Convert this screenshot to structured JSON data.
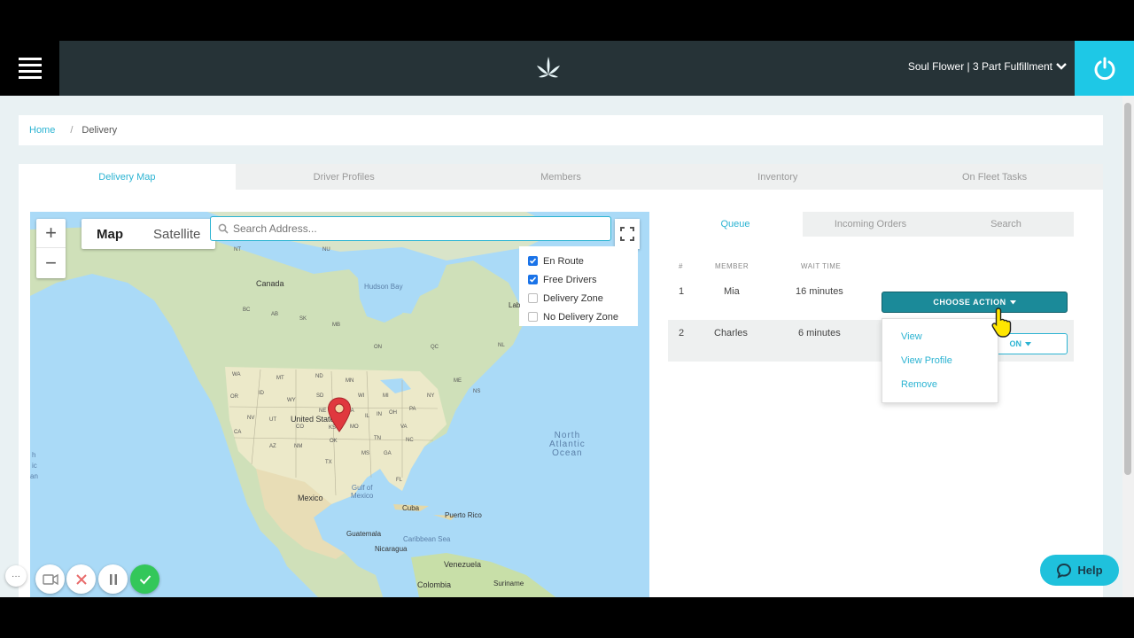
{
  "header": {
    "account_label": "Soul Flower | 3 Part Fulfillment",
    "icons": {
      "menu": "hamburger-icon",
      "logo": "leaf-logo",
      "power": "power-icon",
      "chevron": "chevron-down-icon"
    }
  },
  "breadcrumb": {
    "home": "Home",
    "separator": "/",
    "current": "Delivery"
  },
  "tabs": [
    "Delivery Map",
    "Driver Profiles",
    "Members",
    "Inventory",
    "On Fleet Tasks"
  ],
  "map": {
    "zoom_in": "+",
    "zoom_out": "−",
    "type_map": "Map",
    "type_satellite": "Satellite",
    "search_placeholder": "Search Address...",
    "filters": [
      {
        "label": "En Route",
        "checked": true
      },
      {
        "label": "Free Drivers",
        "checked": true
      },
      {
        "label": "Delivery Zone",
        "checked": false
      },
      {
        "label": "No Delivery Zone",
        "checked": false
      }
    ],
    "labels": {
      "canada": "Canada",
      "hudson_bay": "Hudson Bay",
      "united_states": "United States",
      "mexico": "Mexico",
      "gulf": "Gulf of\nMexico",
      "atlantic": "North\nAtlantic\nOcean",
      "cuba": "Cuba",
      "puerto_rico": "Puerto Rico",
      "caribbean": "Caribbean Sea",
      "guatemala": "Guatemala",
      "nicaragua": "Nicaragua",
      "venezuela": "Venezuela",
      "colombia": "Colombia",
      "suriname": "Suriname",
      "lab": "Lab",
      "pac1": "h",
      "pac2": "ic",
      "pac3": "an",
      "nt": "NT",
      "nu": "NU",
      "bc": "BC",
      "ab": "AB",
      "sk": "SK",
      "mb": "MB",
      "on": "ON",
      "qc": "QC",
      "nl": "NL",
      "wa": "WA",
      "mt": "MT",
      "nd": "ND",
      "mn": "MN",
      "or": "OR",
      "id": "ID",
      "wy": "WY",
      "sd": "SD",
      "wi": "WI",
      "mi": "MI",
      "ny": "NY",
      "nv": "NV",
      "ut": "UT",
      "co": "CO",
      "ks": "KS",
      "mo": "MO",
      "ca": "CA",
      "az": "AZ",
      "nm": "NM",
      "ok": "OK",
      "tx": "TX",
      "ms": "MS",
      "ga": "GA",
      "fl": "FL",
      "in": "IN",
      "oh": "OH",
      "pa": "PA",
      "va": "VA",
      "nc": "NC",
      "tn": "TN",
      "me": "ME",
      "ns": "NS",
      "ne": "NE",
      "ia": "IA",
      "il": "IL"
    }
  },
  "queue": {
    "subtabs": [
      "Queue",
      "Incoming Orders",
      "Search"
    ],
    "columns": [
      "#",
      "MEMBER",
      "WAIT TIME"
    ],
    "rows": [
      {
        "num": "1",
        "member": "Mia",
        "wait": "16 minutes"
      },
      {
        "num": "2",
        "member": "Charles",
        "wait": "6 minutes"
      }
    ],
    "action_label": "CHOOSE ACTION",
    "action_label_partial": "ON",
    "menu_items": [
      "View",
      "View Profile",
      "Remove"
    ]
  },
  "help_label": "Help",
  "recorder": {
    "more": "···"
  },
  "colors": {
    "accent": "#2bb3d2",
    "header": "#263337",
    "power": "#1ec8e6",
    "action": "#1b8a99",
    "help": "#1fc1dc"
  }
}
